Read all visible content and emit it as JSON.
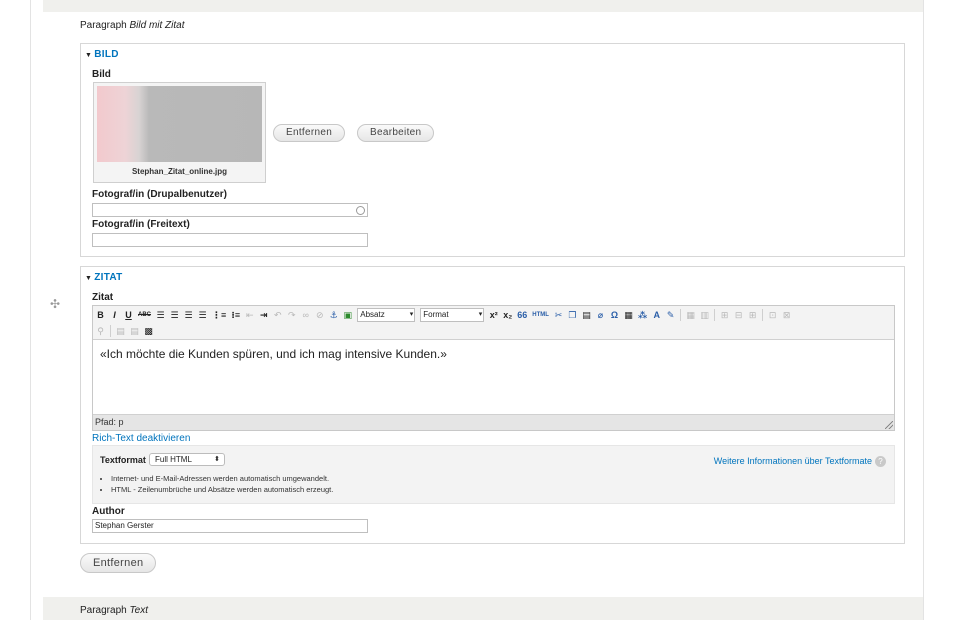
{
  "paragraph_top": {
    "prefix": "Paragraph",
    "type": "Bild mit Zitat"
  },
  "paragraph_bottom": {
    "prefix": "Paragraph",
    "type": "Text"
  },
  "bild": {
    "legend": "BILD",
    "image_label": "Bild",
    "file_name": "Stephan_Zitat_online.jpg",
    "remove_label": "Entfernen",
    "edit_label": "Bearbeiten",
    "photographer_user_label": "Fotograf/in (Drupalbenutzer)",
    "photographer_user_value": "",
    "photographer_text_label": "Fotograf/in (Freitext)",
    "photographer_text_value": ""
  },
  "zitat": {
    "legend": "ZITAT",
    "field_label": "Zitat",
    "toolbar": {
      "bold": "B",
      "italic": "I",
      "underline": "U",
      "strike": "ABC",
      "format_block": "Absatz",
      "format_style": "Format",
      "superscript": "x²",
      "subscript": "x₂",
      "blockquote": "66",
      "html": "HTML"
    },
    "content": "«Ich möchte die Kunden spüren, und ich mag intensive Kunden.»",
    "path": "Pfad: p",
    "toggle_rich_text": "Rich-Text deaktivieren",
    "text_format": {
      "label": "Textformat",
      "selected": "Full HTML",
      "more_info": "Weitere Informationen über Textformate",
      "tips": [
        "Internet- und E-Mail-Adressen werden automatisch umgewandelt.",
        "HTML - Zeilenumbrüche und Absätze werden automatisch erzeugt."
      ]
    },
    "author_label": "Author",
    "author_value": "Stephan Gerster"
  },
  "remove_paragraph_label": "Entfernen",
  "icons": {
    "drag": "drag-handle-icon",
    "collapse": "triangle-down-icon",
    "help": "help-icon"
  },
  "colors": {
    "link": "#0074bd",
    "band": "#f0f0ed"
  }
}
